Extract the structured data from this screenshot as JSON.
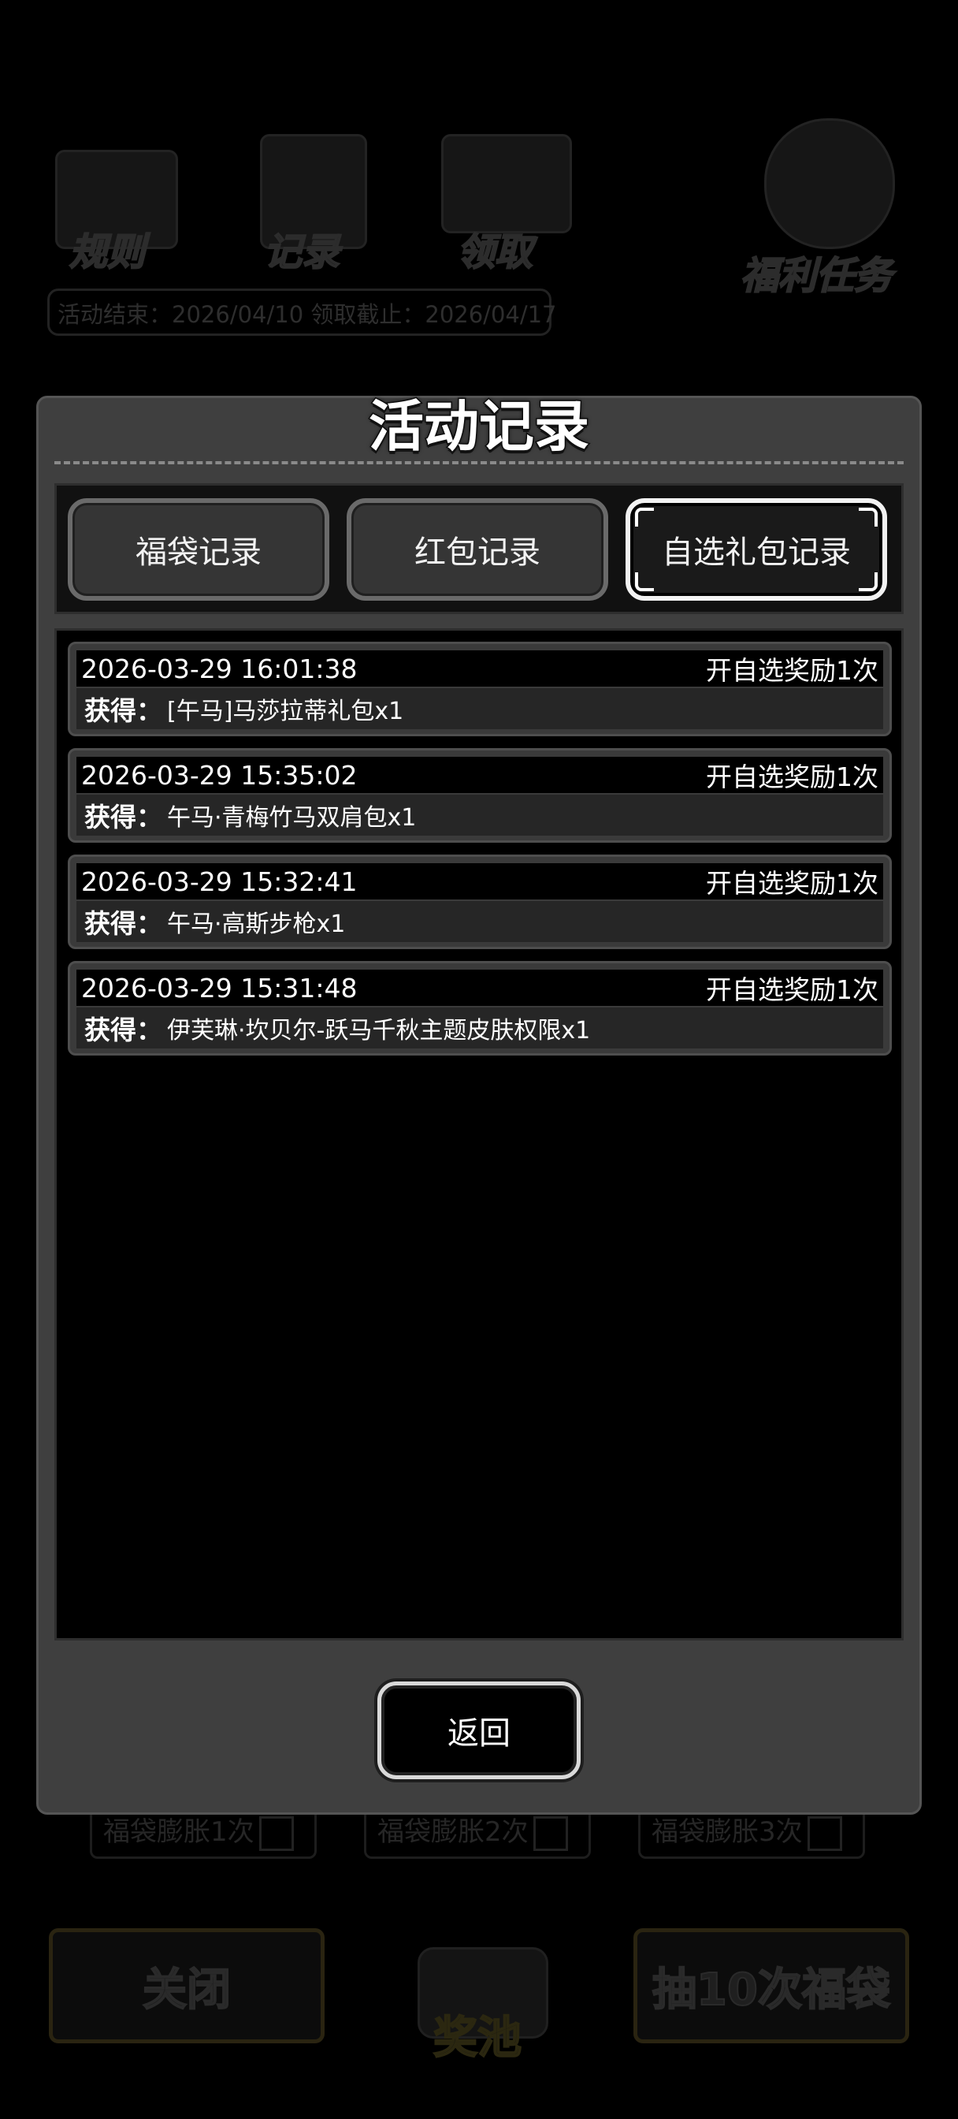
{
  "background": {
    "top_icons": [
      {
        "label": "规则",
        "icon": "book-icon"
      },
      {
        "label": "记录",
        "icon": "scroll-icon"
      },
      {
        "label": "领取",
        "icon": "mailbox-icon"
      },
      {
        "label": "福利任务",
        "icon": "target-icon"
      }
    ],
    "date_text": "活动结束：2026/04/10  领取截止：2026/04/17",
    "expand": [
      "福袋膨胀1次",
      "福袋膨胀2次",
      "福袋膨胀3次"
    ],
    "close_label": "关闭",
    "pool_label": "奖池",
    "draw_label": "抽10次福袋"
  },
  "modal": {
    "title": "活动记录",
    "tabs": [
      "福袋记录",
      "红包记录",
      "自选礼包记录"
    ],
    "active_tab": 2,
    "records": [
      {
        "time": "2026-03-29 16:01:38",
        "action": "开自选奖励1次",
        "prefix": "获得：",
        "item": "[午马]马莎拉蒂礼包x1"
      },
      {
        "time": "2026-03-29 15:35:02",
        "action": "开自选奖励1次",
        "prefix": "获得：",
        "item": "午马·青梅竹马双肩包x1"
      },
      {
        "time": "2026-03-29 15:32:41",
        "action": "开自选奖励1次",
        "prefix": "获得：",
        "item": "午马·高斯步枪x1"
      },
      {
        "time": "2026-03-29 15:31:48",
        "action": "开自选奖励1次",
        "prefix": "获得：",
        "item": "伊芙琳·坎贝尔-跃马千秋主题皮肤权限x1"
      }
    ],
    "back_label": "返回"
  }
}
